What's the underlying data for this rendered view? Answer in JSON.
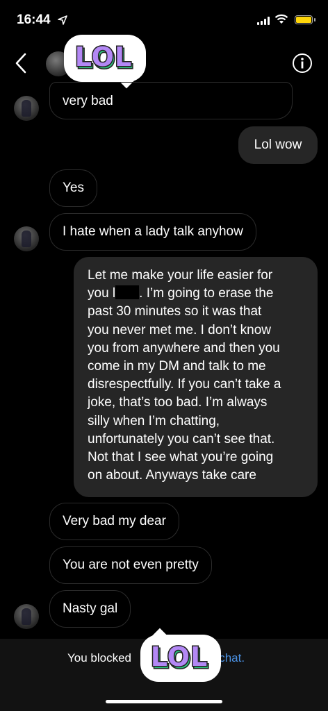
{
  "status": {
    "time": "16:44"
  },
  "header": {
    "sticker": "LOL"
  },
  "messages": {
    "m1": "very bad",
    "m2": "Lol wow",
    "m3": "Yes",
    "m4": "I hate when a lady talk anyhow",
    "m5_lines": [
      "Let me make your life easier for",
      "you l",
      ". I’m going to erase the",
      "past 30 minutes so it was that",
      "you never met me. I don’t know",
      "you from anywhere and then you",
      "come in my DM and talk to me",
      "disrespectfully. If you can’t take a",
      "joke, that’s too bad. I’m always",
      "silly when I’m chatting,",
      "unfortunately you can’t see that.",
      "Not that I see what you’re going",
      "on about. Anyways take care"
    ],
    "m6": "Very bad my dear",
    "m7": "You are not even pretty",
    "m8": "Nasty gal"
  },
  "footer": {
    "text": "You blocked",
    "link": "e chat.",
    "sticker": "LOL"
  },
  "colors": {
    "link": "#4a90e2",
    "sticker_purple": "#b388f5",
    "sticker_green": "#2ec27e"
  }
}
